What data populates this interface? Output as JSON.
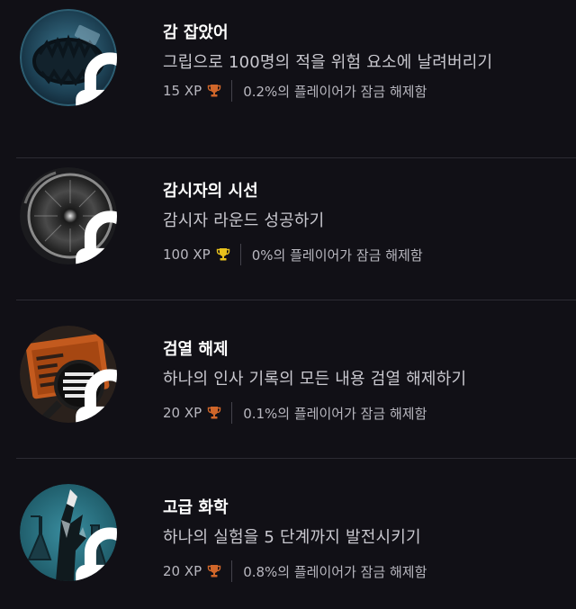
{
  "achievements": [
    {
      "title": "감 잡았어",
      "description": "그립으로 100명의 적을 위험 요소에 날려버리기",
      "xp": "15 XP",
      "unlock_rate": "0.2%의 플레이어가 잠금 해제함",
      "trophy": "bronze-trophy-icon",
      "trophy_color": "#d0662a",
      "locked": true
    },
    {
      "title": "감시자의 시선",
      "description": "감시자 라운드 성공하기",
      "xp": "100 XP",
      "unlock_rate": "0%의 플레이어가 잠금 해제함",
      "trophy": "gold-trophy-icon",
      "trophy_color": "#e8c21c",
      "locked": true
    },
    {
      "title": "검열 해제",
      "description": "하나의 인사 기록의 모든 내용 검열 해제하기",
      "xp": "20 XP",
      "unlock_rate": "0.1%의 플레이어가 잠금 해제함",
      "trophy": "bronze-trophy-icon",
      "trophy_color": "#d0662a",
      "locked": true
    },
    {
      "title": "고급 화학",
      "description": "하나의 실험을 5 단계까지 발전시키기",
      "xp": "20 XP",
      "unlock_rate": "0.8%의 플레이어가 잠금 해제함",
      "trophy": "bronze-trophy-icon",
      "trophy_color": "#d0662a",
      "locked": true
    }
  ]
}
